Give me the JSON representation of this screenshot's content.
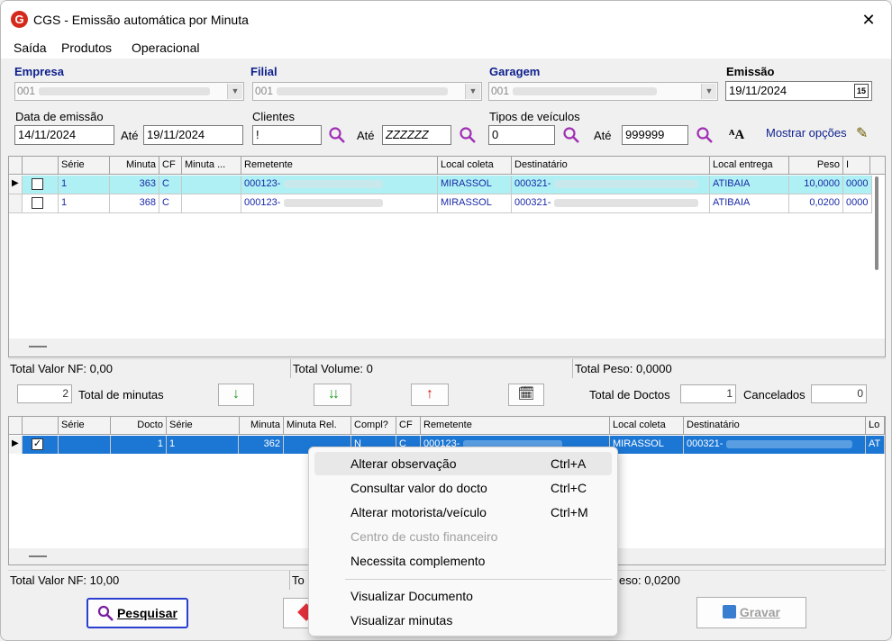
{
  "window": {
    "title": "CGS - Emissão automática por Minuta"
  },
  "menu": [
    "Saída",
    "Produtos",
    "Operacional"
  ],
  "filters": {
    "empresa_label": "Empresa",
    "empresa_value": "001",
    "filial_label": "Filial",
    "filial_value": "001",
    "garagem_label": "Garagem",
    "garagem_value": "001",
    "emissao_label": "Emissão",
    "emissao_value": "19/11/2024",
    "data_emissao_label": "Data de emissão",
    "data_emissao_from": "14/11/2024",
    "ate_label": "Até",
    "data_emissao_to": "19/11/2024",
    "clientes_label": "Clientes",
    "clientes_from": "!",
    "clientes_to": "ZZZZZZ",
    "tipos_label": "Tipos de veículos",
    "tipos_from": "0",
    "tipos_to": "999999",
    "mostrar_opcoes": "Mostrar opções"
  },
  "grid1": {
    "columns": [
      "Série",
      "Minuta",
      "CF",
      "Minuta ...",
      "Remetente",
      "Local coleta",
      "Destinatário",
      "Local entrega",
      "Peso",
      "I"
    ],
    "rows": [
      {
        "serie": "1",
        "minuta": "363",
        "cf": "C",
        "minuta2": "",
        "remetente": "000123-",
        "local_coleta": "MIRASSOL",
        "destinatario": "000321-",
        "local_entrega": "ATIBAIA",
        "peso": "10,0000",
        "extra": "0000"
      },
      {
        "serie": "1",
        "minuta": "368",
        "cf": "C",
        "minuta2": "",
        "remetente": "000123-",
        "local_coleta": "MIRASSOL",
        "destinatario": "000321-",
        "local_entrega": "ATIBAIA",
        "peso": "0,0200",
        "extra": "0000"
      }
    ]
  },
  "totals1": {
    "valor_nf_label": "Total Valor NF:",
    "valor_nf": "0,00",
    "volume_label": "Total Volume:",
    "volume": "0",
    "peso_label": "Total Peso:",
    "peso": "0,0000"
  },
  "middle": {
    "total_minutas_value": "2",
    "total_minutas_label": "Total de minutas",
    "total_doctos_label": "Total de Doctos",
    "total_doctos_value": "1",
    "cancelados_label": "Cancelados",
    "cancelados_value": "0"
  },
  "grid2": {
    "columns": [
      "Série",
      "Docto",
      "Série",
      "Minuta",
      "Minuta Rel.",
      "Compl?",
      "CF",
      "Remetente",
      "Local coleta",
      "Destinatário",
      "Lo"
    ],
    "rows": [
      {
        "serie": "",
        "docto": "1",
        "serie2": "1",
        "minuta": "362",
        "minuta_rel": "",
        "compl": "N",
        "cf": "C",
        "remetente": "000123-",
        "local_coleta": "MIRASSOL",
        "destinatario": "000321-",
        "lo": "AT"
      }
    ]
  },
  "totals2": {
    "valor_nf_label": "Total Valor NF:",
    "valor_nf": "10,00",
    "volume_label": "To",
    "peso_label": "eso:",
    "peso": "0,0200"
  },
  "buttons": {
    "pesquisar": "Pesquisar",
    "gravar": "Gravar"
  },
  "context_menu": [
    {
      "label": "Alterar observação",
      "shortcut": "Ctrl+A"
    },
    {
      "label": "Consultar valor do docto",
      "shortcut": "Ctrl+C"
    },
    {
      "label": "Alterar motorista/veículo",
      "shortcut": "Ctrl+M"
    },
    {
      "label": "Centro de custo financeiro",
      "shortcut": ""
    },
    {
      "label": "Necessita complemento",
      "shortcut": ""
    },
    {
      "label": "Visualizar Documento",
      "shortcut": ""
    },
    {
      "label": "Visualizar minutas",
      "shortcut": ""
    }
  ],
  "colors": {
    "accent_blue": "#0d1f8c",
    "row_selected": "#aef0f4",
    "row_selected_dark": "#1c77d4",
    "app_icon_red": "#d42a1c"
  }
}
